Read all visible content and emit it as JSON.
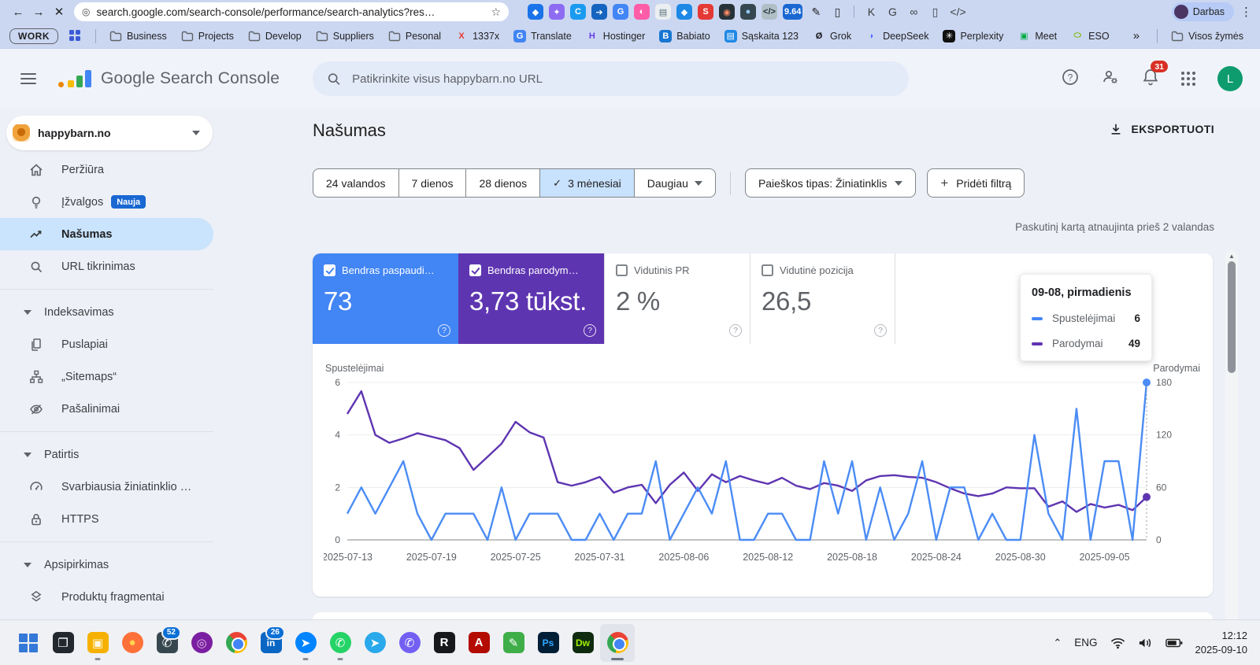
{
  "browser": {
    "url": "search.google.com/search-console/performance/search-analytics?res…",
    "back_glyph": "←",
    "forward_glyph": "→",
    "close_glyph": "✕",
    "site_info_glyph": "◎",
    "star_glyph": "☆",
    "kebab_glyph": "⋮",
    "profile_label": "Darbas",
    "extensions": [
      {
        "name": "maps-pin-extension-icon",
        "glyph": "◆",
        "bg": "#1a73e8",
        "fg": "#ffffff"
      },
      {
        "name": "puzzle-extension-icon",
        "glyph": "✦",
        "bg": "#8e6cf1",
        "fg": "#ffffff"
      },
      {
        "name": "blue-c-extension-icon",
        "glyph": "C",
        "bg": "#1a9bf0",
        "fg": "#ffffff"
      },
      {
        "name": "share-extension-icon",
        "glyph": "➔",
        "bg": "#1565c0",
        "fg": "#ffffff"
      },
      {
        "name": "translate-extension-icon",
        "glyph": "G",
        "bg": "#4285f4",
        "fg": "#ffffff"
      },
      {
        "name": "color-wheel-extension-icon",
        "glyph": "◐",
        "bg": "#ff5ca8",
        "fg": "#ffffff"
      },
      {
        "name": "notes-extension-icon",
        "glyph": "▤",
        "bg": "#eceff1",
        "fg": "#546e7a"
      },
      {
        "name": "price-tag-extension-icon",
        "glyph": "◆",
        "bg": "#1e88e5",
        "fg": "#ffffff"
      },
      {
        "name": "seo-extension-icon",
        "glyph": "S",
        "bg": "#e53935",
        "fg": "#ffffff"
      },
      {
        "name": "camera-extension-icon",
        "glyph": "◉",
        "bg": "#263238",
        "fg": "#ff8a65"
      },
      {
        "name": "dark-sphere-extension-icon",
        "glyph": "●",
        "bg": "#37474f",
        "fg": "#90caf9"
      },
      {
        "name": "code-extension-icon",
        "glyph": "</>",
        "bg": "#b0bec5",
        "fg": "#263238"
      },
      {
        "name": "pagespeed-score-extension-icon",
        "glyph": "9.64",
        "bg": "#1967d2",
        "fg": "#ffffff"
      },
      {
        "name": "eyedropper-extension-icon",
        "glyph": "✎",
        "fg": "#202124",
        "plain": true
      },
      {
        "name": "clipboard-extension-icon",
        "glyph": "▯",
        "fg": "#202124",
        "plain": true
      },
      {
        "divider": true
      },
      {
        "name": "password-key-icon",
        "glyph": "K",
        "fg": "#3c4043",
        "plain": true
      },
      {
        "name": "translate-page-icon",
        "glyph": "G",
        "fg": "#3c4043",
        "plain": true
      },
      {
        "name": "link-icon",
        "glyph": "∞",
        "fg": "#3c4043",
        "plain": true
      },
      {
        "name": "trash-icon",
        "glyph": "▯",
        "fg": "#3c4043",
        "plain": true
      },
      {
        "name": "devtools-icon",
        "glyph": "</>",
        "fg": "#3c4043",
        "plain": true
      }
    ]
  },
  "bookmarks": {
    "work_label": "WORK",
    "overflow_glyph": "»",
    "all_label": "Visos žymės",
    "items": [
      {
        "label": "Business",
        "icon": "folder"
      },
      {
        "label": "Projects",
        "icon": "folder"
      },
      {
        "label": "Develop",
        "icon": "folder"
      },
      {
        "label": "Suppliers",
        "icon": "folder"
      },
      {
        "label": "Pesonal",
        "icon": "folder"
      },
      {
        "label": "1337x",
        "glyph": "X",
        "fg": "#e53935",
        "plain": true
      },
      {
        "label": "Translate",
        "glyph": "G",
        "bg": "#4285f4",
        "fg": "#ffffff"
      },
      {
        "label": "Hostinger",
        "glyph": "H",
        "fg": "#673de6",
        "plain": true
      },
      {
        "label": "Babiato",
        "glyph": "B",
        "bg": "#1976d2",
        "fg": "#ffffff"
      },
      {
        "label": "Sąskaita 123",
        "glyph": "▤",
        "bg": "#1e88e5",
        "fg": "#ffffff"
      },
      {
        "label": "Grok",
        "glyph": "Ø",
        "fg": "#111111",
        "plain": true
      },
      {
        "label": "DeepSeek",
        "glyph": "◗",
        "fg": "#4d6bfe",
        "plain": true
      },
      {
        "label": "Perplexity",
        "glyph": "✳",
        "bg": "#111111",
        "fg": "#ffffff"
      },
      {
        "label": "Meet",
        "glyph": "▣",
        "fg": "#00ac47",
        "plain": true
      },
      {
        "label": "ESO",
        "glyph": "⬭",
        "fg": "#7ab800",
        "plain": true
      }
    ]
  },
  "app": {
    "product_name": "Google Search Console",
    "search_placeholder": "Patikrinkite visus happybarn.no URL",
    "notification_count": "31",
    "avatar_letter": "L",
    "property": "happybarn.no"
  },
  "sidebar": {
    "items": [
      {
        "type": "item",
        "label": "Peržiūra",
        "icon": "home"
      },
      {
        "type": "item",
        "label": "Įžvalgos",
        "icon": "bulb",
        "badge": "Nauja"
      },
      {
        "type": "item",
        "label": "Našumas",
        "icon": "trend",
        "active": true
      },
      {
        "type": "item",
        "label": "URL tikrinimas",
        "icon": "search"
      },
      {
        "type": "divider"
      },
      {
        "type": "section",
        "label": "Indeksavimas"
      },
      {
        "type": "item",
        "label": "Puslapiai",
        "icon": "pages"
      },
      {
        "type": "item",
        "label": "„Sitemaps“",
        "icon": "sitemap"
      },
      {
        "type": "item",
        "label": "Pašalinimai",
        "icon": "eyeoff"
      },
      {
        "type": "divider"
      },
      {
        "type": "section",
        "label": "Patirtis"
      },
      {
        "type": "item",
        "label": "Svarbiausia žiniatinklio …",
        "icon": "gauge"
      },
      {
        "type": "item",
        "label": "HTTPS",
        "icon": "lock"
      },
      {
        "type": "divider"
      },
      {
        "type": "section",
        "label": "Apsipirkimas"
      },
      {
        "type": "item",
        "label": "Produktų fragmentai",
        "icon": "layers"
      }
    ]
  },
  "page": {
    "title": "Našumas",
    "export_label": "EKSPORTUOTI",
    "date_chips": [
      "24 valandos",
      "7 dienos",
      "28 dienos",
      "3 mėnesiai",
      "Daugiau"
    ],
    "selected_chip": "3 mėnesiai",
    "more_chip": "Daugiau",
    "search_type_chip": "Paieškos tipas: Žiniatinklis",
    "add_filter_chip": "Pridėti filtrą",
    "last_updated": "Paskutinį kartą atnaujinta prieš 2 valandas",
    "metrics": [
      {
        "label": "Bendras paspaudi…",
        "value": "73",
        "selected": true,
        "color": "#4285f4"
      },
      {
        "label": "Bendras parodym…",
        "value": "3,73 tūkst.",
        "selected": true,
        "color": "#5e35b1"
      },
      {
        "label": "Vidutinis PR",
        "value": "2 %",
        "selected": false
      },
      {
        "label": "Vidutinė pozicija",
        "value": "26,5",
        "selected": false
      }
    ],
    "tooltip": {
      "title": "09-08, pirmadienis",
      "rows": [
        {
          "label": "Spustelėjimai",
          "value": "6",
          "color": "#4285f4"
        },
        {
          "label": "Parodymai",
          "value": "49",
          "color": "#5e35b1"
        }
      ]
    }
  },
  "chart_data": {
    "type": "line",
    "title": "Našumas: Spustelėjimai ir Parodymai per 3 mėnesius",
    "x": [
      "2025-07-13",
      "2025-07-14",
      "2025-07-15",
      "2025-07-16",
      "2025-07-17",
      "2025-07-18",
      "2025-07-19",
      "2025-07-20",
      "2025-07-21",
      "2025-07-22",
      "2025-07-23",
      "2025-07-24",
      "2025-07-25",
      "2025-07-26",
      "2025-07-27",
      "2025-07-28",
      "2025-07-29",
      "2025-07-30",
      "2025-07-31",
      "2025-08-01",
      "2025-08-02",
      "2025-08-03",
      "2025-08-04",
      "2025-08-05",
      "2025-08-06",
      "2025-08-07",
      "2025-08-08",
      "2025-08-09",
      "2025-08-10",
      "2025-08-11",
      "2025-08-12",
      "2025-08-13",
      "2025-08-14",
      "2025-08-15",
      "2025-08-16",
      "2025-08-17",
      "2025-08-18",
      "2025-08-19",
      "2025-08-20",
      "2025-08-21",
      "2025-08-22",
      "2025-08-23",
      "2025-08-24",
      "2025-08-25",
      "2025-08-26",
      "2025-08-27",
      "2025-08-28",
      "2025-08-29",
      "2025-08-30",
      "2025-08-31",
      "2025-09-01",
      "2025-09-02",
      "2025-09-03",
      "2025-09-04",
      "2025-09-05",
      "2025-09-06",
      "2025-09-07",
      "2025-09-08"
    ],
    "series": [
      {
        "name": "Spustelėjimai",
        "axis": "left",
        "color": "#4b8cf5",
        "values": [
          1,
          2,
          1,
          2,
          3,
          1,
          0,
          1,
          1,
          1,
          0,
          2,
          0,
          1,
          1,
          1,
          0,
          0,
          1,
          0,
          1,
          1,
          3,
          0,
          1,
          2,
          1,
          3,
          0,
          0,
          1,
          1,
          0,
          0,
          3,
          1,
          3,
          0,
          2,
          0,
          1,
          3,
          0,
          2,
          2,
          0,
          1,
          0,
          0,
          4,
          1,
          0,
          5,
          0,
          3,
          3,
          0,
          6
        ]
      },
      {
        "name": "Parodymai",
        "axis": "right",
        "color": "#5e35b1",
        "values": [
          144,
          170,
          120,
          111,
          116,
          122,
          118,
          114,
          105,
          80,
          95,
          110,
          135,
          123,
          117,
          66,
          62,
          66,
          72,
          54,
          60,
          63,
          42,
          63,
          77,
          56,
          75,
          66,
          73,
          68,
          64,
          71,
          62,
          58,
          65,
          62,
          56,
          68,
          73,
          74,
          72,
          71,
          66,
          59,
          53,
          50,
          53,
          60,
          59,
          59,
          38,
          44,
          32,
          41,
          37,
          40,
          34,
          49
        ]
      }
    ],
    "left_axis": {
      "label": "Spustelėjimai",
      "ticks": [
        0,
        2,
        4,
        6
      ],
      "max": 6
    },
    "right_axis": {
      "label": "Parodymai",
      "ticks": [
        0,
        60,
        120,
        180
      ],
      "max": 180
    },
    "x_ticks": [
      {
        "i": 0,
        "label": "2025-07-13"
      },
      {
        "i": 6,
        "label": "2025-07-19"
      },
      {
        "i": 12,
        "label": "2025-07-25"
      },
      {
        "i": 18,
        "label": "2025-07-31"
      },
      {
        "i": 24,
        "label": "2025-08-06"
      },
      {
        "i": 30,
        "label": "2025-08-12"
      },
      {
        "i": 36,
        "label": "2025-08-18"
      },
      {
        "i": 42,
        "label": "2025-08-24"
      },
      {
        "i": 48,
        "label": "2025-08-30"
      },
      {
        "i": 54,
        "label": "2025-09-05"
      }
    ],
    "hover_index": 57,
    "hover_values": {
      "Spustelėjimai": 6,
      "Parodymai": 49
    },
    "grid": true,
    "legend_position": "tooltip-only"
  },
  "taskbar": {
    "icons": [
      {
        "name": "start-button",
        "type": "windows"
      },
      {
        "name": "task-view-icon",
        "type": "glyph",
        "glyph": "❐",
        "bg": "#23272e",
        "fg": "#ffffff",
        "shape": "rounded"
      },
      {
        "name": "file-explorer-icon",
        "type": "glyph",
        "glyph": "▣",
        "bg": "#f6b100",
        "fg": "#fff8e1",
        "shape": "rounded",
        "indicator": true
      },
      {
        "name": "firefox-icon",
        "type": "glyph",
        "glyph": "●",
        "bg": "#ff7139",
        "fg": "#ffd54f",
        "shape": "circle"
      },
      {
        "name": "phone-link-icon",
        "type": "glyph",
        "glyph": "✆",
        "bg": "#37474f",
        "fg": "#ffffff",
        "shape": "rounded",
        "badge": "52"
      },
      {
        "name": "media-app-icon",
        "type": "glyph",
        "glyph": "◎",
        "bg": "#7b1fa2",
        "fg": "#e1bee7",
        "shape": "circle"
      },
      {
        "name": "chrome-icon",
        "type": "chrome"
      },
      {
        "name": "linkedin-icon",
        "type": "glyph",
        "glyph": "in",
        "bg": "#0a66c2",
        "fg": "#ffffff",
        "shape": "rounded",
        "badge": "26"
      },
      {
        "name": "messenger-icon",
        "type": "glyph",
        "glyph": "➤",
        "bg": "#0084ff",
        "fg": "#ffffff",
        "shape": "circle",
        "indicator": true
      },
      {
        "name": "whatsapp-icon",
        "type": "glyph",
        "glyph": "✆",
        "bg": "#25d366",
        "fg": "#ffffff",
        "shape": "circle",
        "indicator": true
      },
      {
        "name": "telegram-icon",
        "type": "glyph",
        "glyph": "➤",
        "bg": "#29a9eb",
        "fg": "#ffffff",
        "shape": "circle"
      },
      {
        "name": "viber-icon",
        "type": "glyph",
        "glyph": "✆",
        "bg": "#7360f2",
        "fg": "#ffffff",
        "shape": "circle"
      },
      {
        "name": "mirc-icon",
        "type": "glyph",
        "glyph": "R",
        "bg": "#17181c",
        "fg": "#ffffff",
        "shape": "rounded"
      },
      {
        "name": "acrobat-icon",
        "type": "glyph",
        "glyph": "A",
        "bg": "#b30b00",
        "fg": "#ffffff",
        "shape": "rounded"
      },
      {
        "name": "editor-icon",
        "type": "glyph",
        "glyph": "✎",
        "bg": "#3fae49",
        "fg": "#ffffff",
        "shape": "rounded"
      },
      {
        "name": "photoshop-icon",
        "type": "glyph",
        "glyph": "Ps",
        "bg": "#001e36",
        "fg": "#31a8ff",
        "shape": "rounded"
      },
      {
        "name": "dreamweaver-icon",
        "type": "glyph",
        "glyph": "Dw",
        "bg": "#0f2b0f",
        "fg": "#9eef00",
        "shape": "rounded"
      },
      {
        "name": "chrome-active-icon",
        "type": "chrome",
        "active": true,
        "indicator": true
      }
    ],
    "tray": {
      "chevron": "⌃",
      "lang": "ENG",
      "time": "12:12",
      "date": "2025-09-10"
    }
  }
}
